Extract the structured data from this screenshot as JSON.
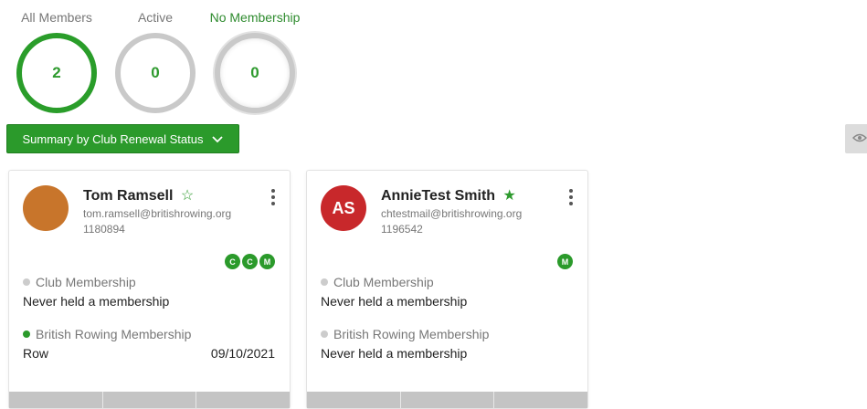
{
  "stats": [
    {
      "label": "All Members",
      "value": "2"
    },
    {
      "label": "Active",
      "value": "0"
    },
    {
      "label": "No Membership",
      "value": "0"
    }
  ],
  "summary_button": {
    "label": "Summary by Club Renewal Status"
  },
  "members": [
    {
      "name": "Tom Ramsell",
      "favorite": false,
      "email": "tom.ramsell@britishrowing.org",
      "member_number": "1180894",
      "avatar_initials": "",
      "avatar_color": "#c8752b",
      "badges": [
        "C",
        "C",
        "M"
      ],
      "club_membership": {
        "label": "Club Membership",
        "status_color": "#cccccc",
        "value": "Never held a membership"
      },
      "br_membership": {
        "label": "British Rowing Membership",
        "status_color": "#2b9a2b",
        "value": "Row",
        "date": "09/10/2021"
      }
    },
    {
      "name": "AnnieTest Smith",
      "favorite": true,
      "email": "chtestmail@britishrowing.org",
      "member_number": "1196542",
      "avatar_initials": "AS",
      "avatar_color": "#c8282b",
      "badges": [
        "M"
      ],
      "club_membership": {
        "label": "Club Membership",
        "status_color": "#cccccc",
        "value": "Never held a membership"
      },
      "br_membership": {
        "label": "British Rowing Membership",
        "status_color": "#cccccc",
        "value": "Never held a membership",
        "date": ""
      }
    }
  ],
  "colors": {
    "accent": "#2b9a2b",
    "star": "#2e9a2e"
  }
}
